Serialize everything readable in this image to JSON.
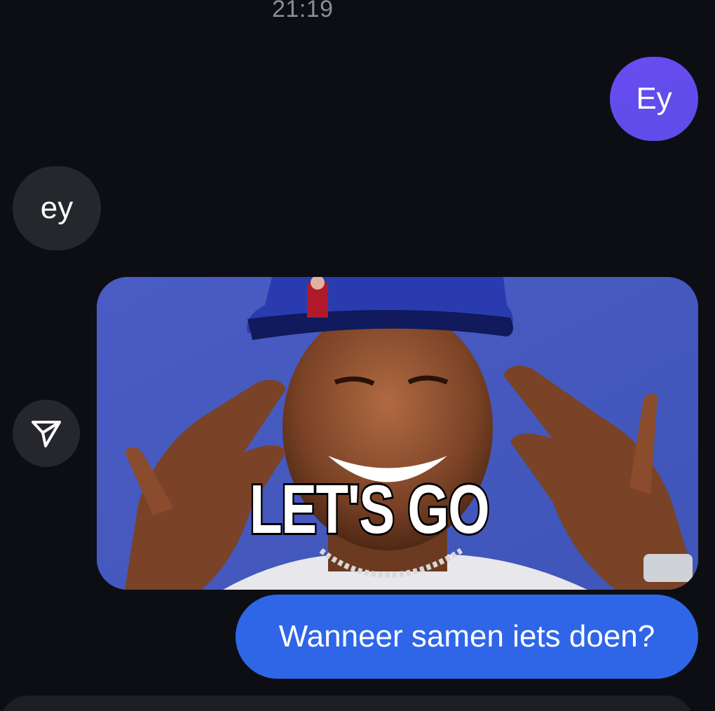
{
  "thread": {
    "timestamp": "21:19",
    "messages": [
      {
        "direction": "outgoing",
        "type": "text",
        "text": "Ey",
        "color": "#5b4de8"
      },
      {
        "direction": "incoming",
        "type": "text",
        "text": "ey",
        "color": "#25272d"
      },
      {
        "direction": "outgoing",
        "type": "image",
        "caption": "LET'S GO"
      },
      {
        "direction": "outgoing",
        "type": "text",
        "text": "Wanneer samen iets doen?",
        "color": "#2f66e8"
      }
    ]
  },
  "icons": {
    "share": "paper-plane-icon"
  },
  "colors": {
    "background": "#0c0e13",
    "incoming_bubble": "#25272d",
    "outgoing_purple": "#5b4de8",
    "outgoing_blue": "#2f66e8"
  }
}
